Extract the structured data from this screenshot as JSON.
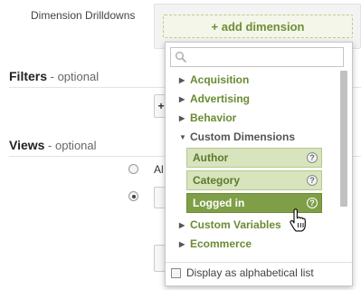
{
  "form": {
    "dimension_label": "Dimension Drilldowns",
    "add_dimension": "+ add dimension",
    "filters_title": "Filters",
    "filters_optional": " - optional",
    "filters_button": "+",
    "views_title": "Views",
    "views_optional": " - optional",
    "views_radio_text": "Al"
  },
  "dropdown": {
    "search_placeholder": "",
    "categories": [
      {
        "label": "Acquisition",
        "expanded": false
      },
      {
        "label": "Advertising",
        "expanded": false
      },
      {
        "label": "Behavior",
        "expanded": false
      },
      {
        "label": "Custom Dimensions",
        "expanded": true
      },
      {
        "label": "Custom Variables",
        "expanded": false
      },
      {
        "label": "Ecommerce",
        "expanded": false
      }
    ],
    "custom_dimensions": [
      {
        "label": "Author",
        "help": "?"
      },
      {
        "label": "Category",
        "help": "?"
      },
      {
        "label": "Logged in",
        "help": "?",
        "hovered": true
      }
    ],
    "footer_checkbox_label": "Display as alphabetical list",
    "footer_checked": false
  },
  "icons": {
    "search": "search-icon",
    "collapsed": "triangle-right-icon",
    "expanded": "triangle-down-icon",
    "help": "question-circle-icon",
    "cursor": "hand-pointer-icon"
  },
  "colors": {
    "accent_green": "#6b8b33",
    "item_bg": "#d7e4bd",
    "item_active_bg": "#7f9f47"
  }
}
